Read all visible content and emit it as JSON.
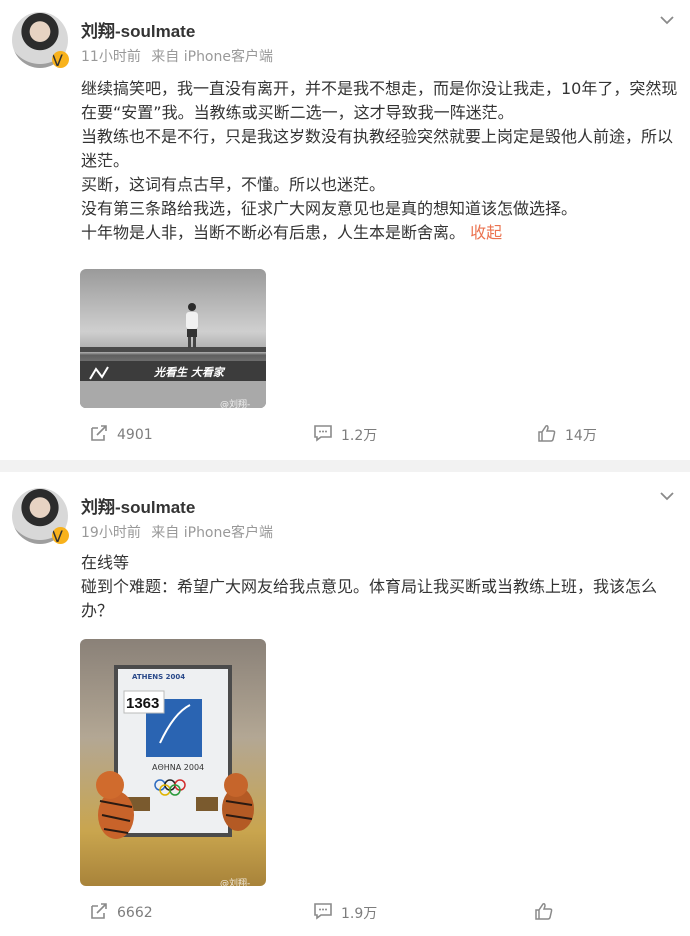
{
  "posts": [
    {
      "author": "刘翔-soulmate",
      "time": "11小时前",
      "source": "来自 iPhone客户端",
      "paragraphs": [
        "继续搞笑吧，我一直没有离开，并不是我不想走，而是你没让我走，10年了，突然现在要“安置”我。当教练或买断二选一，这才导致我一阵迷茫。",
        "当教练也不是不行，只是我这岁数没有执教经验突然就要上岗定是毁他人前途，所以迷茫。",
        "买断，这词有点古早，不懂。所以也迷茫。",
        "没有第三条路给我选，征求广大网友意见也是真的想知道该怎做选择。",
        "十年物是人非，当断不断必有后患，人生本是断舍离。"
      ],
      "collapse_label": "收起",
      "image_caption": "光看生 大看家",
      "watermark": "@刘翔-soulmate",
      "reposts": "4901",
      "comments": "1.2万",
      "likes": "14万"
    },
    {
      "author": "刘翔-soulmate",
      "time": "19小时前",
      "source": "来自 iPhone客户端",
      "paragraphs": [
        "在线等",
        "碰到个难题：希望广大网友给我点意见。体育局让我买断或当教练上班，我该怎么办？"
      ],
      "frame_top": "ATHENS 2004",
      "bib_number": "1363",
      "frame_bottom": "ΑΘΗΝΑ 2004",
      "watermark": "@刘翔-soulmate",
      "reposts": "6662",
      "comments": "1.9万"
    }
  ],
  "icons": {
    "verified": "verified-badge-icon",
    "more": "chevron-down-icon",
    "repost": "repost-icon",
    "comment": "comment-icon",
    "like": "like-icon"
  },
  "colors": {
    "accent": "#eb7350",
    "verified": "#f8b21c",
    "meta": "#999999"
  }
}
